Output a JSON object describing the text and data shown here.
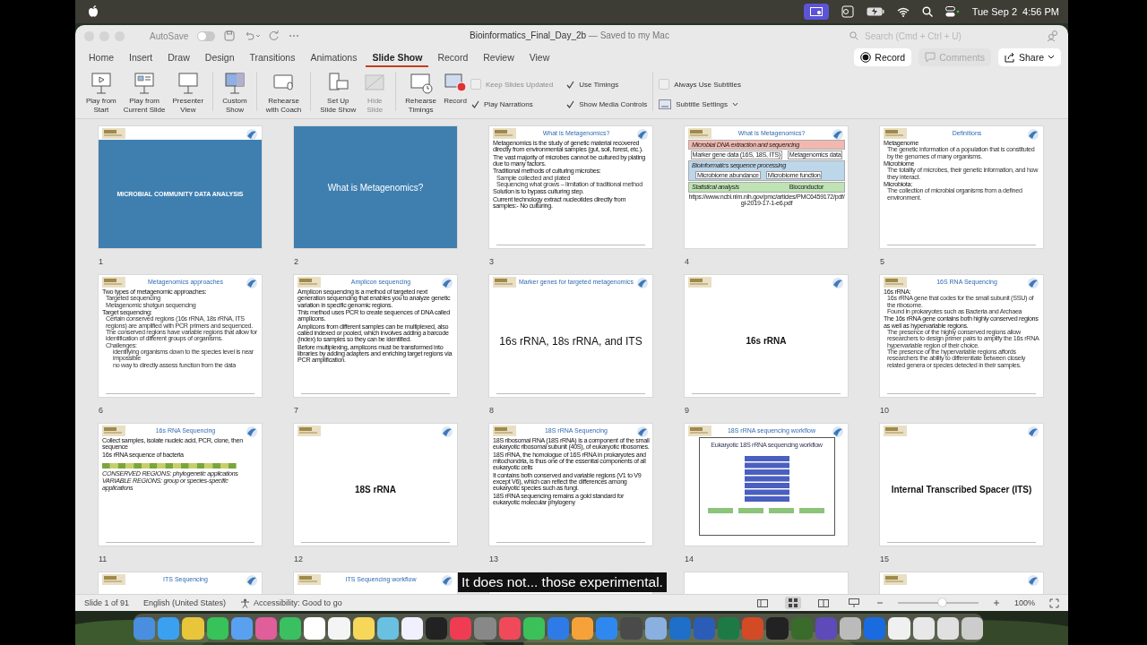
{
  "menu_bar": {
    "date": "Tue Sep 2",
    "time": "4:56 PM"
  },
  "window": {
    "autosave_label": "AutoSave",
    "autosave_on": false,
    "title": "Bioinformatics_Final_Day_2b",
    "save_state": "— Saved to my Mac",
    "search": {
      "placeholder": "Search (Cmd + Ctrl + U)"
    }
  },
  "tabs": [
    {
      "label": "Home",
      "selected": false
    },
    {
      "label": "Insert",
      "selected": false
    },
    {
      "label": "Draw",
      "selected": false
    },
    {
      "label": "Design",
      "selected": false
    },
    {
      "label": "Transitions",
      "selected": false
    },
    {
      "label": "Animations",
      "selected": false
    },
    {
      "label": "Slide Show",
      "selected": true
    },
    {
      "label": "Record",
      "selected": false
    },
    {
      "label": "Review",
      "selected": false
    },
    {
      "label": "View",
      "selected": false
    }
  ],
  "header_buttons": [
    {
      "kind": "record",
      "label": "Record",
      "disabled": false
    },
    {
      "kind": "comments",
      "label": "Comments",
      "disabled": true
    },
    {
      "kind": "share",
      "label": "Share",
      "disabled": false
    }
  ],
  "ribbon": {
    "buttons": [
      {
        "kind": "play",
        "label": "Play from\nStart",
        "disabled": false
      },
      {
        "kind": "current",
        "label": "Play from\nCurrent Slide",
        "disabled": false
      },
      {
        "kind": "presenter",
        "label": "Presenter\nView",
        "disabled": false
      },
      {
        "kind": "custom",
        "label": "Custom\nShow",
        "disabled": false
      },
      {
        "kind": "coach",
        "label": "Rehearse\nwith Coach",
        "disabled": false
      },
      {
        "kind": "setup",
        "label": "Set Up\nSlide Show",
        "disabled": false
      },
      {
        "kind": "hide",
        "label": "Hide\nSlide",
        "disabled": true
      },
      {
        "kind": "timings",
        "label": "Rehearse\nTimings",
        "disabled": false
      },
      {
        "kind": "record",
        "label": "Record",
        "disabled": false
      }
    ],
    "options": [
      {
        "label": "Keep Slides Updated",
        "checked": false,
        "disabled": true
      },
      {
        "label": "Play Narrations",
        "checked": true,
        "disabled": false
      },
      {
        "label": "Use Timings",
        "checked": true,
        "disabled": false
      },
      {
        "label": "Show Media Controls",
        "checked": true,
        "disabled": false
      },
      {
        "label": "Always Use Subtitles",
        "checked": false,
        "disabled": false
      }
    ],
    "subtitle_settings": "Subtitle Settings"
  },
  "slides": [
    {
      "number": "1",
      "kind": "section",
      "logo": true,
      "title": "MICROBIAL COMMUNITY DATA ANALYSIS"
    },
    {
      "number": "2",
      "kind": "section",
      "logo": false,
      "title": "What is Metagenomics?"
    },
    {
      "number": "3",
      "kind": "bullets",
      "logo": true,
      "title": "What is Metagenomics?",
      "bullets": [
        {
          "text": "Metagenomics is the study of genetic material recovered directly from environmental samples (gut, soil, forest, etc.)."
        },
        {
          "text": "The vast majority of microbes cannot be cultured by plating due to many factors."
        },
        {
          "text": "Traditional methods of culturing microbes:",
          "children": [
            {
              "text": "Sample collected and plated"
            },
            {
              "text": "Sequencing what grows – limitation of traditional method"
            }
          ]
        },
        {
          "text": "Solution is to bypass culturing step."
        },
        {
          "text": "Current technology extract nucleotides directly from samples:- No culturing."
        }
      ]
    },
    {
      "number": "4",
      "kind": "pipeline",
      "logo": true,
      "title": "What is Metagenomics?",
      "stages": [
        {
          "label": "Microbial DNA extraction and sequencing",
          "color": "#f2b8b0"
        },
        {
          "label": "Marker gene data (16S, 18S, ITS)",
          "color": "#ffffff"
        },
        {
          "label": "Metagenomics data",
          "color": "#ffffff"
        },
        {
          "label": "Bioinformatics sequence processing",
          "color": "#bcd6ea"
        },
        {
          "label": "Microbiome abundance",
          "color": "#ffffff"
        },
        {
          "label": "Microbiome function",
          "color": "#ffffff"
        },
        {
          "label": "Statistical analysis",
          "color": "#bfe3b4"
        },
        {
          "label": "Bioconductor",
          "color": "#bfe3b4"
        }
      ],
      "source": "https://www.ncbi.nlm.nih.gov/pmc/articles/PMC6459172/pdf/gi-2019-17-1-e6.pdf"
    },
    {
      "number": "5",
      "kind": "bullets",
      "logo": true,
      "title": "Definitions",
      "bullets": [
        {
          "text": "Metagenome",
          "children": [
            {
              "text": "The genetic information of a population that is constituted by the genomes of many organisms."
            }
          ]
        },
        {
          "text": "Microbiome",
          "children": [
            {
              "text": "The totality of microbes, their genetic information, and how they interact."
            }
          ]
        },
        {
          "text": "Microbiota:",
          "children": [
            {
              "text": "The collection of microbial organisms from a defined environment."
            }
          ]
        }
      ]
    },
    {
      "number": "6",
      "kind": "bullets",
      "logo": true,
      "title": "Metagenomics approaches",
      "bullets": [
        {
          "text": "Two types of metagenomic approaches:",
          "children": [
            {
              "text": "Targeted sequencing"
            },
            {
              "text": "Metagenomic shotgun sequencing"
            }
          ]
        },
        {
          "text": "Target sequencing:",
          "children": [
            {
              "text": "Certain conserved regions (16s rRNA, 18s rRNA, ITS regions) are amplified with PCR primers and sequenced."
            },
            {
              "text": "The conserved regions have variable regions that allow for identification of different groups of organisms."
            },
            {
              "text": "Challenges:",
              "children": [
                {
                  "text": "identifying organisms down to the species level is near impossible"
                },
                {
                  "text": "no way to directly assess function from the data"
                }
              ]
            }
          ]
        }
      ]
    },
    {
      "number": "7",
      "kind": "bullets",
      "logo": true,
      "title": "Amplicon sequencing",
      "bullets": [
        {
          "text": "Amplicon sequencing is a method of targeted next generation sequencing that enables you to analyze genetic variation in specific genomic regions."
        },
        {
          "text": "This method uses PCR to create sequences of DNA called amplicons."
        },
        {
          "text": "Amplicons from different samples can be multiplexed, also called indexed or pooled, which involves adding a barcode (index) to samples so they can be identified."
        },
        {
          "text": "Before multiplexing, amplicons must be transformed into libraries by adding adapters and enriching target regions via PCR amplification."
        }
      ]
    },
    {
      "number": "8",
      "kind": "statement",
      "logo": true,
      "title": "Marker genes for targeted metagenomics",
      "statement": "16s rRNA, 18s rRNA, and ITS",
      "bold": false
    },
    {
      "number": "9",
      "kind": "statement",
      "logo": true,
      "statement": "16s rRNA",
      "bold": true
    },
    {
      "number": "10",
      "kind": "bullets",
      "logo": true,
      "title": "16S RNA Sequencing",
      "bullets": [
        {
          "text": "16s rRNA:",
          "children": [
            {
              "text": "16s rRNA gene that codes for the small subunit (SSU) of the ribosome."
            },
            {
              "text": "Found in prokaryotes such as Bacteria and Archaea"
            }
          ]
        },
        {
          "text": "The 16s rRNA gene contains both highly conserved regions as well as hypervariable regions.",
          "children": [
            {
              "text": "The presence of the highly conserved regions allow researchers to design primer pairs to amplify the 16s rRNA hypervariable region of their choice."
            },
            {
              "text": "The presence of the hypervariable regions affords researchers the ability to differentiate between closely related genera or species detected in their samples."
            }
          ]
        }
      ]
    },
    {
      "number": "11",
      "kind": "bullets",
      "logo": true,
      "title": "16s RNA Sequencing",
      "bullets": [
        {
          "text": "Collect samples, isolate nucleic acid, PCR, clone, then sequence"
        },
        {
          "text": "16s rRNA sequence of bacteria"
        }
      ],
      "figure": {
        "kind": "region-map",
        "labels": [
          "CONSERVED REGIONS: phylogenetic applications",
          "VARIABLE REGIONS: group or species-specific applications"
        ]
      }
    },
    {
      "number": "12",
      "kind": "statement",
      "logo": true,
      "statement": "18S rRNA",
      "bold": true
    },
    {
      "number": "13",
      "kind": "bullets",
      "logo": true,
      "title": "18S rRNA Sequencing",
      "bullets": [
        {
          "text": "18S ribosomal RNA (18S rRNA) is a component of the small eukaryotic ribosomal subunit (40S), of eukaryotic ribosomes."
        },
        {
          "text": "18S rRNA, the homologue of 16S rRNA in prokaryotes and mitochondria, is thus one of the essential components of all eukaryotic cells"
        },
        {
          "text": "It contains both conserved and variable regions (V1 to V9 except V6), which can reflect the differences among eukaryotic species such as fungi."
        },
        {
          "text": "18S rRNA sequencing remains a gold standard for eukaryotic molecular phylogeny"
        }
      ]
    },
    {
      "number": "14",
      "kind": "workflow",
      "logo": true,
      "title": "18S rRNA sequencing workflow",
      "caption": "Eukaryotic 18S rRNA sequencing workflow"
    },
    {
      "number": "15",
      "kind": "statement",
      "logo": true,
      "statement": "Internal Transcribed Spacer (ITS)",
      "bold": true
    },
    {
      "kind": "bullets",
      "logo": true,
      "title": "ITS Sequencing"
    },
    {
      "kind": "bullets",
      "logo": true,
      "title": "ITS Sequencing workflow"
    },
    {
      "kind": "bullets",
      "logo": false
    },
    {
      "kind": "bullets",
      "logo": false
    },
    {
      "kind": "bullets",
      "logo": true
    }
  ],
  "status_bar": {
    "slide": "Slide 1 of 91",
    "language": "English (United States)",
    "accessibility": "Accessibility: Good to go",
    "zoom": {
      "level": 0.55,
      "reading": "100%"
    }
  },
  "caption": "It does not... those experimental."
}
